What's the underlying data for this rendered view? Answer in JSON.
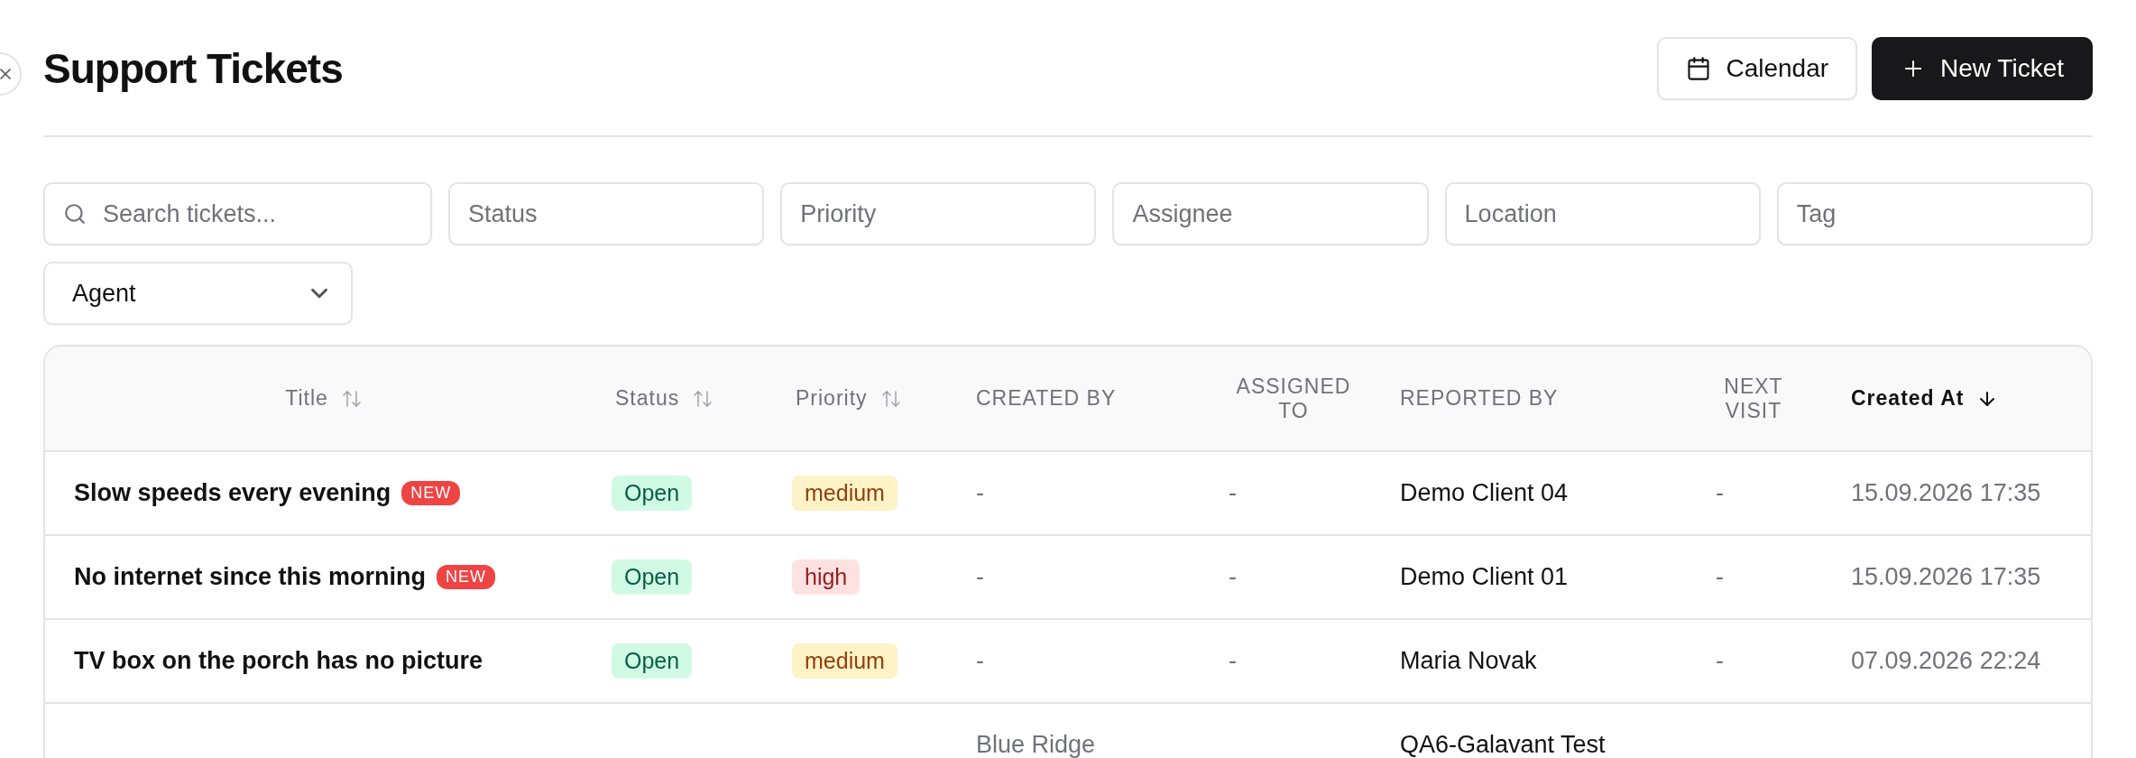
{
  "page": {
    "title": "Support Tickets"
  },
  "actions": [
    {
      "kind": "calendar",
      "label": "Calendar"
    },
    {
      "kind": "new",
      "label": "New Ticket"
    }
  ],
  "filters": [
    {
      "kind": "search",
      "placeholder": "Search tickets..."
    },
    {
      "kind": "text",
      "placeholder": "Status"
    },
    {
      "kind": "text",
      "placeholder": "Priority"
    },
    {
      "kind": "text",
      "placeholder": "Assignee"
    },
    {
      "kind": "text",
      "placeholder": "Location"
    },
    {
      "kind": "text",
      "placeholder": "Tag"
    },
    {
      "kind": "select",
      "value": "Agent"
    }
  ],
  "table": {
    "columns": [
      {
        "label": "Title",
        "sorted": false
      },
      {
        "label": "Status",
        "sorted": false
      },
      {
        "label": "Priority",
        "sorted": false
      },
      {
        "label": "CREATED BY"
      },
      {
        "label": "ASSIGNED TO"
      },
      {
        "label": "REPORTED BY"
      },
      {
        "label": "NEXT VISIT"
      },
      {
        "label": "Created At",
        "sorted": true
      }
    ],
    "rows": [
      {
        "title": "Slow speeds every evening",
        "badge": "NEW",
        "status": {
          "text": "Open",
          "kind": "open"
        },
        "priority": {
          "text": "medium",
          "kind": "medium"
        },
        "created_by": "-",
        "assigned_to": "-",
        "reported_by": "Demo Client 04",
        "next_visit": "-",
        "created_at": "15.09.2026 17:35"
      },
      {
        "title": "No internet since this morning",
        "badge": "NEW",
        "status": {
          "text": "Open",
          "kind": "open"
        },
        "priority": {
          "text": "high",
          "kind": "high"
        },
        "created_by": "-",
        "assigned_to": "-",
        "reported_by": "Demo Client 01",
        "next_visit": "-",
        "created_at": "15.09.2026 17:35"
      },
      {
        "title": "TV box on the porch has no picture",
        "status": {
          "text": "Open",
          "kind": "open"
        },
        "priority": {
          "text": "medium",
          "kind": "medium"
        },
        "created_by": "-",
        "assigned_to": "-",
        "reported_by": "Maria Novak",
        "next_visit": "-",
        "created_at": "07.09.2026 22:24"
      },
      {
        "created_by": "Blue Ridge",
        "reported_by": "QA6-Galavant Test"
      }
    ]
  }
}
